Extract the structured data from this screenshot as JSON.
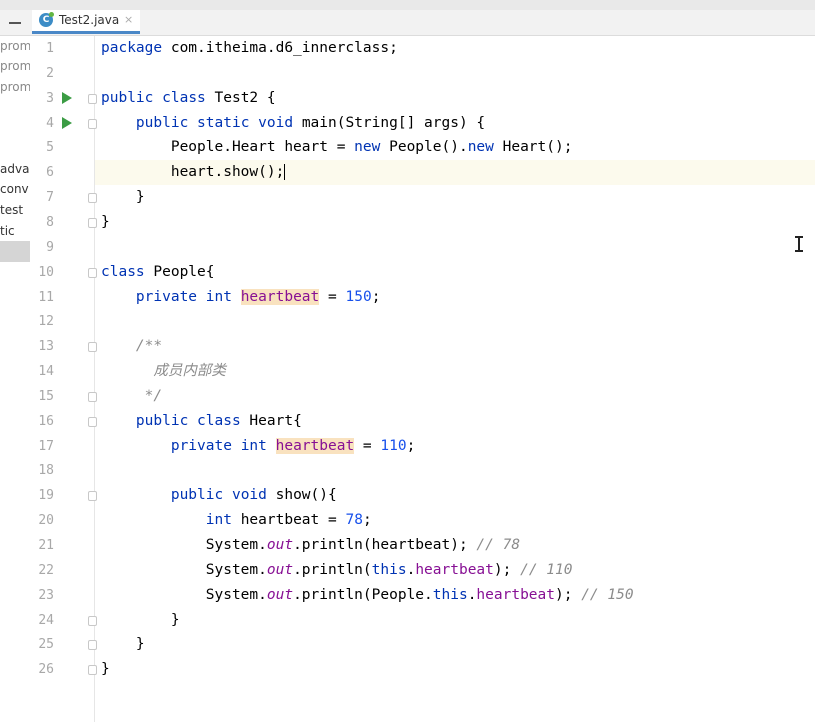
{
  "tab": {
    "filename": "Test2.java",
    "close": "×",
    "icon": "java-class-icon"
  },
  "project_panel": {
    "items": [
      "prom",
      "prom",
      "prom",
      "adva",
      "conv",
      "test",
      "tic"
    ]
  },
  "code_lines": [
    {
      "n": "1",
      "t": "package com.itheima.d6_innerclass;"
    },
    {
      "n": "2",
      "t": ""
    },
    {
      "n": "3",
      "t": "public class Test2 {"
    },
    {
      "n": "4",
      "t": "    public static void main(String[] args) {"
    },
    {
      "n": "5",
      "t": "        People.Heart heart = new People().new Heart();"
    },
    {
      "n": "6",
      "t": "        heart.show();"
    },
    {
      "n": "7",
      "t": "    }"
    },
    {
      "n": "8",
      "t": "}"
    },
    {
      "n": "9",
      "t": ""
    },
    {
      "n": "10",
      "t": "class People{"
    },
    {
      "n": "11",
      "t": "    private int heartbeat = 150;"
    },
    {
      "n": "12",
      "t": ""
    },
    {
      "n": "13",
      "t": "    /**"
    },
    {
      "n": "14",
      "t": "      成员内部类"
    },
    {
      "n": "15",
      "t": "     */"
    },
    {
      "n": "16",
      "t": "    public class Heart{"
    },
    {
      "n": "17",
      "t": "        private int heartbeat = 110;"
    },
    {
      "n": "18",
      "t": ""
    },
    {
      "n": "19",
      "t": "        public void show(){"
    },
    {
      "n": "20",
      "t": "            int heartbeat = 78;"
    },
    {
      "n": "21",
      "t": "            System.out.println(heartbeat); // 78"
    },
    {
      "n": "22",
      "t": "            System.out.println(this.heartbeat); // 110"
    },
    {
      "n": "23",
      "t": "            System.out.println(People.this.heartbeat); // 150"
    },
    {
      "n": "24",
      "t": "        }"
    },
    {
      "n": "25",
      "t": "    }"
    },
    {
      "n": "26",
      "t": "}"
    }
  ],
  "current_line": "6",
  "colors": {
    "keyword": "#0033b3",
    "field": "#871094",
    "number": "#1750eb",
    "comment": "#8c8c8c",
    "run_icon": "#3b9c44"
  }
}
